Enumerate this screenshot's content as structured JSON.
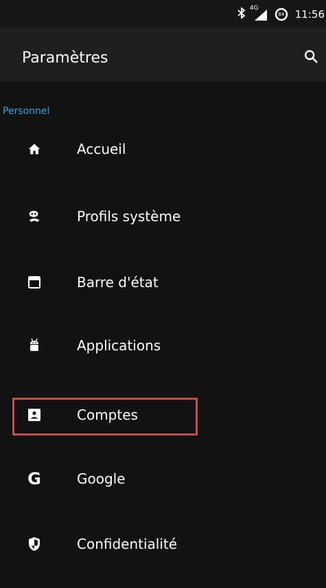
{
  "status_bar": {
    "bluetooth_icon": "bluetooth-icon",
    "network_label": "4G",
    "battery_level": "84",
    "time": "11:56"
  },
  "app_bar": {
    "title": "Paramètres",
    "search_icon": "search-icon"
  },
  "section": {
    "title": "Personnel"
  },
  "items": [
    {
      "label": "Accueil",
      "icon": "home-icon"
    },
    {
      "label": "Profils système",
      "icon": "profiles-icon"
    },
    {
      "label": "Barre d'état",
      "icon": "status-bar-icon"
    },
    {
      "label": "Applications",
      "icon": "android-icon"
    },
    {
      "label": "Comptes",
      "icon": "account-box-icon"
    },
    {
      "label": "Google",
      "icon": "google-icon"
    },
    {
      "label": "Confidentialité",
      "icon": "shield-icon"
    }
  ],
  "colors": {
    "background": "#121212",
    "app_bar": "#1f1f1f",
    "accent": "#29a8e0",
    "highlight": "#c0504d"
  }
}
